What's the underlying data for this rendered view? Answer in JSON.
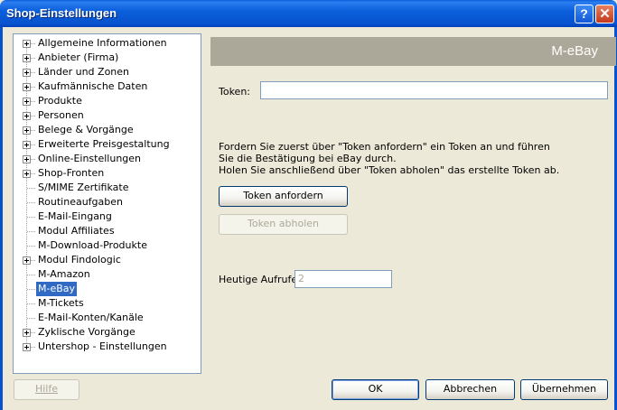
{
  "window": {
    "title": "Shop-Einstellungen",
    "help_glyph": "?",
    "close_glyph": "✕"
  },
  "tree": {
    "items": [
      {
        "label": "Allgemeine Informationen",
        "expandable": true,
        "selected": false
      },
      {
        "label": "Anbieter (Firma)",
        "expandable": true,
        "selected": false
      },
      {
        "label": "Länder und Zonen",
        "expandable": true,
        "selected": false
      },
      {
        "label": "Kaufmännische Daten",
        "expandable": true,
        "selected": false
      },
      {
        "label": "Produkte",
        "expandable": true,
        "selected": false
      },
      {
        "label": "Personen",
        "expandable": true,
        "selected": false
      },
      {
        "label": "Belege & Vorgänge",
        "expandable": true,
        "selected": false
      },
      {
        "label": "Erweiterte Preisgestaltung",
        "expandable": true,
        "selected": false
      },
      {
        "label": "Online-Einstellungen",
        "expandable": true,
        "selected": false
      },
      {
        "label": "Shop-Fronten",
        "expandable": true,
        "selected": false
      },
      {
        "label": "S/MIME Zertifikate",
        "expandable": false,
        "selected": false
      },
      {
        "label": "Routineaufgaben",
        "expandable": false,
        "selected": false
      },
      {
        "label": "E-Mail-Eingang",
        "expandable": false,
        "selected": false
      },
      {
        "label": "Modul Affiliates",
        "expandable": false,
        "selected": false
      },
      {
        "label": "M-Download-Produkte",
        "expandable": false,
        "selected": false
      },
      {
        "label": "Modul Findologic",
        "expandable": true,
        "selected": false
      },
      {
        "label": "M-Amazon",
        "expandable": false,
        "selected": false
      },
      {
        "label": "M-eBay",
        "expandable": false,
        "selected": true
      },
      {
        "label": "M-Tickets",
        "expandable": false,
        "selected": false
      },
      {
        "label": "E-Mail-Konten/Kanäle",
        "expandable": false,
        "selected": false
      },
      {
        "label": "Zyklische Vorgänge",
        "expandable": true,
        "selected": false
      },
      {
        "label": "Untershop - Einstellungen",
        "expandable": true,
        "selected": false
      }
    ]
  },
  "panel": {
    "title": "M-eBay",
    "token_label": "Token:",
    "token_value": "",
    "description": [
      "Fordern Sie zuerst über \"Token anfordern\" ein Token an und führen",
      "Sie die Bestätigung bei eBay durch.",
      "Holen Sie anschließend über \"Token abholen\" das erstellte Token ab."
    ],
    "request_token_button": "Token anfordern",
    "fetch_token_button": "Token abholen",
    "calls_today_label": "Heutige Aufrufe:",
    "calls_today_value": "2"
  },
  "footer": {
    "help_button": "Hilfe",
    "ok_button": "OK",
    "cancel_button": "Abbrechen",
    "apply_button": "Übernehmen"
  },
  "colors": {
    "titlebar": "#0752cf",
    "header_bar": "#aca899",
    "selection": "#316ac5",
    "dialog_bg": "#ece9d8"
  }
}
